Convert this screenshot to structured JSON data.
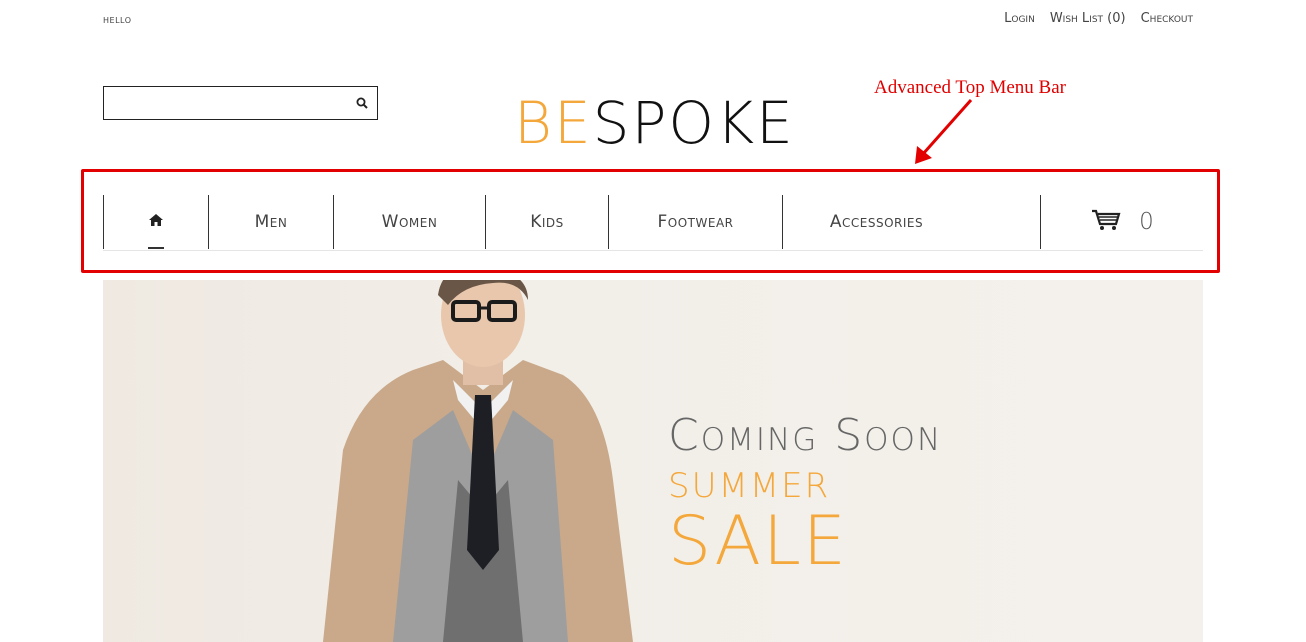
{
  "topbar": {
    "greeting": "HELLO",
    "links": [
      "Login",
      "Wish List (0)",
      "Checkout"
    ]
  },
  "search": {
    "placeholder": "",
    "value": ""
  },
  "logo": {
    "accent": "BE",
    "rest": "SPOKE"
  },
  "annotation": {
    "text": "Advanced Top Menu Bar"
  },
  "menu": {
    "items": [
      "Men",
      "Women",
      "Kids",
      "Footwear",
      "Accessories"
    ],
    "cart_count": "0"
  },
  "banner": {
    "headline": "Coming Soon",
    "subheadline": "SUMMER",
    "sale": "SALE"
  },
  "colors": {
    "accent": "#f4a73a",
    "annotation": "#e00000"
  }
}
